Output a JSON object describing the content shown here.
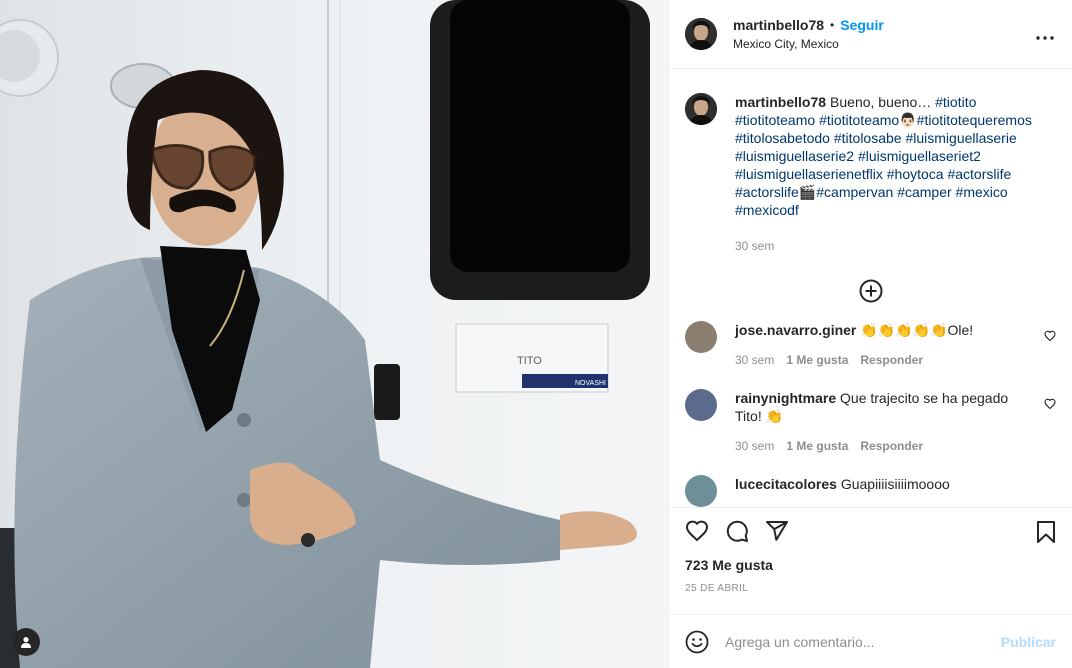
{
  "post": {
    "photo": {
      "name_plate": "TITO",
      "plate_brand": "NOVASHI"
    },
    "header": {
      "username": "martinbello78",
      "separator": "•",
      "follow_label": "Seguir",
      "location": "Mexico City, Mexico"
    },
    "caption": {
      "username": "martinbello78",
      "text_start": "Bueno, bueno… ",
      "segments": [
        {
          "type": "tag",
          "text": "#tiotito"
        },
        {
          "type": "tag",
          "text": "#tiotitoteamo"
        },
        {
          "type": "tag",
          "text": "#tiotitoteamo"
        },
        {
          "type": "emoji",
          "text": "👨🏻"
        },
        {
          "type": "tag",
          "text": "#tiotitotequeremos"
        },
        {
          "type": "tag",
          "text": "#titolosabetodo"
        },
        {
          "type": "tag",
          "text": "#titolosabe"
        },
        {
          "type": "tag",
          "text": "#luismiguellaserie"
        },
        {
          "type": "tag",
          "text": "#luismiguellaserie2"
        },
        {
          "type": "tag",
          "text": "#luismiguellaseriet2"
        },
        {
          "type": "tag",
          "text": "#luismiguellaserienetflix"
        },
        {
          "type": "tag",
          "text": "#hoytoca"
        },
        {
          "type": "tag",
          "text": "#actorslife"
        },
        {
          "type": "tag",
          "text": "#actorslife"
        },
        {
          "type": "emoji",
          "text": "🎬"
        },
        {
          "type": "tag",
          "text": "#campervan"
        },
        {
          "type": "tag",
          "text": "#camper"
        },
        {
          "type": "tag",
          "text": "#mexico"
        },
        {
          "type": "tag",
          "text": "#mexicodf"
        }
      ],
      "time": "30 sem"
    },
    "comments": [
      {
        "username": "jose.navarro.giner",
        "text": "👏👏👏👏👏Ole!",
        "time": "30 sem",
        "likes": "1 Me gusta",
        "reply": "Responder",
        "avatar_color": "#8a7f70"
      },
      {
        "username": "rainynightmare",
        "text": "Que trajecito se ha pegado Tito! 👏",
        "time": "30 sem",
        "likes": "1 Me gusta",
        "reply": "Responder",
        "avatar_color": "#5a6b8c"
      },
      {
        "username": "lucecitacolores",
        "text": "Guapiiiisiiiimoooo",
        "time": "",
        "likes": "",
        "reply": "",
        "avatar_color": "#6c8f9a"
      }
    ],
    "likes_count": "723 Me gusta",
    "date": "25 DE ABRIL",
    "add_comment": {
      "placeholder": "Agrega un comentario...",
      "publish_label": "Publicar"
    },
    "colors": {
      "link_blue": "#0095f6",
      "hashtag": "#00376b",
      "muted": "#8e8e8e",
      "publish_disabled": "#b3dbff"
    }
  }
}
